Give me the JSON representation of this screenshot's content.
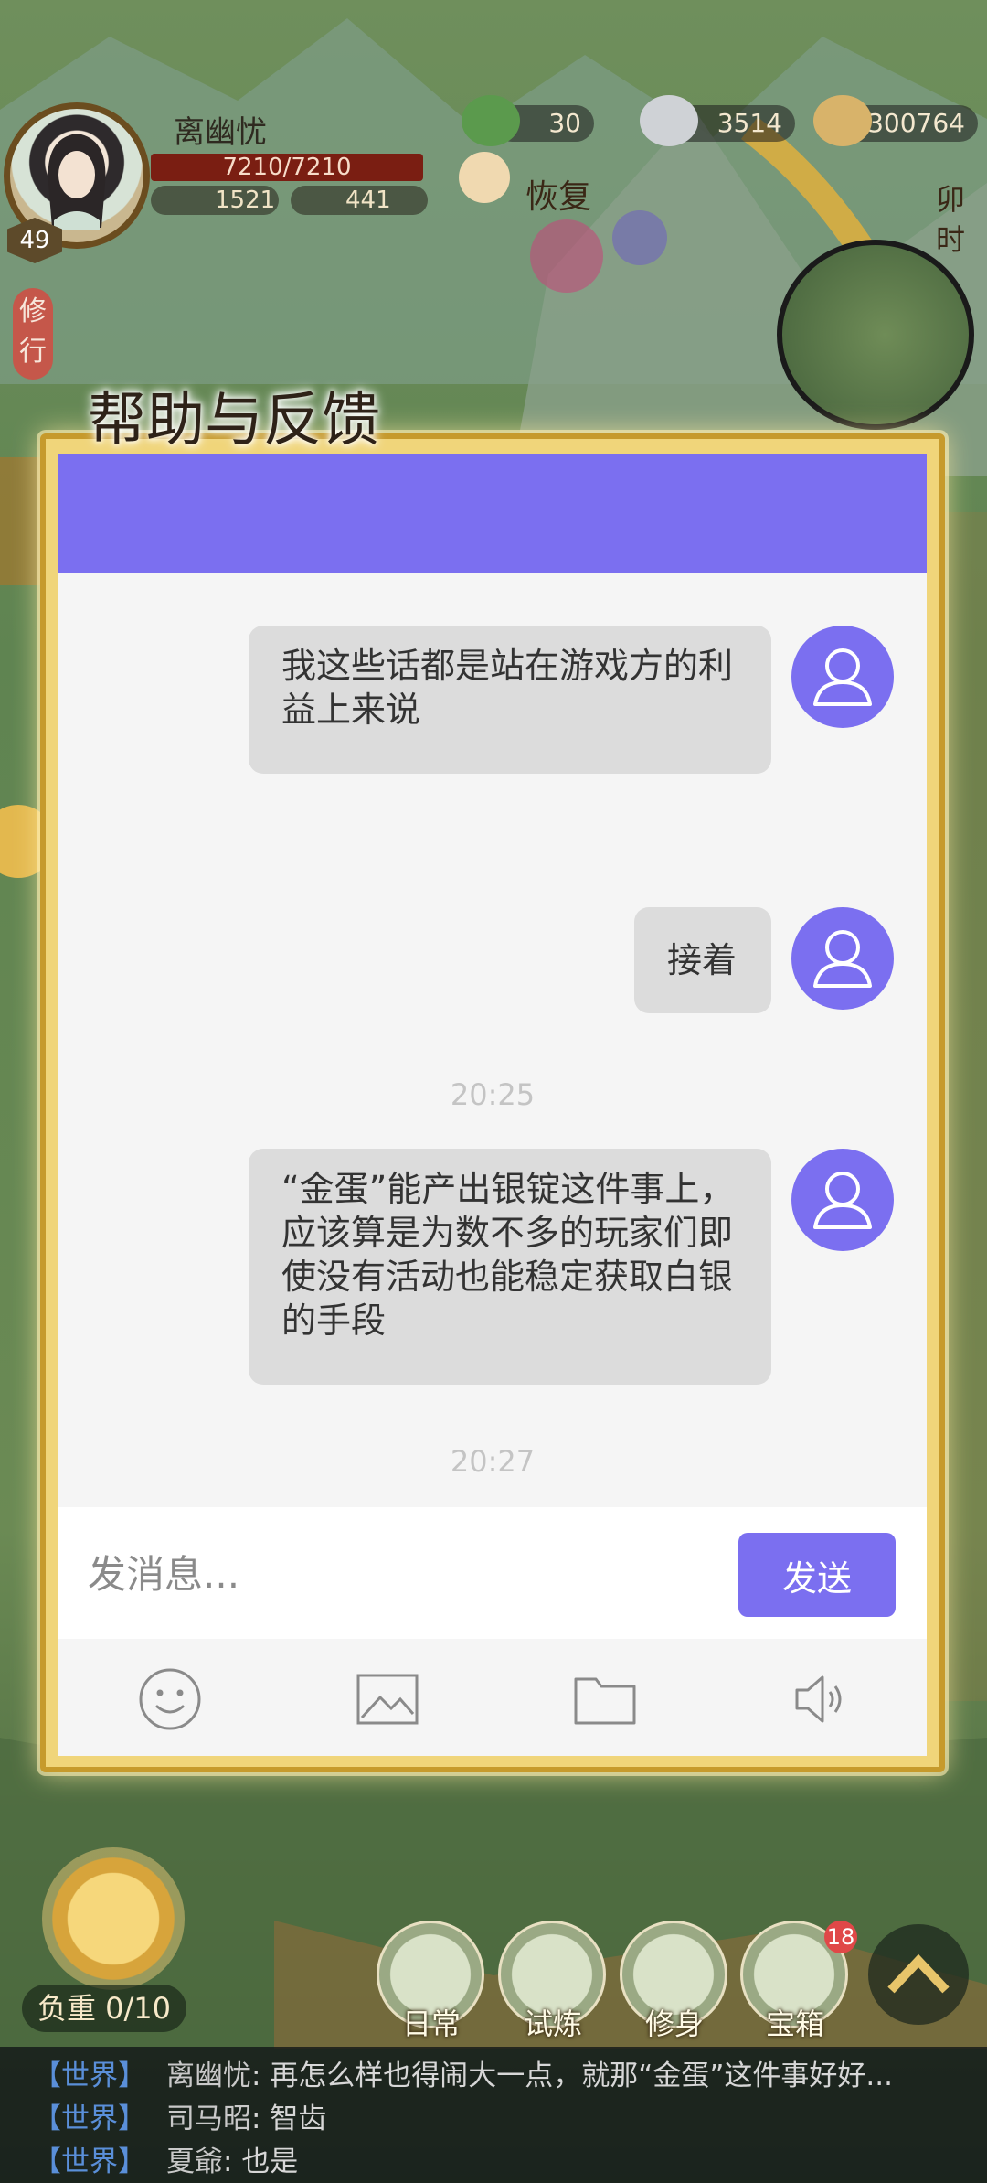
{
  "player": {
    "name": "离幽忧",
    "hp": "7210/7210",
    "stat_a": "1521",
    "stat_b": "441",
    "level": "49"
  },
  "resources": [
    "30",
    "3514",
    "300764"
  ],
  "recover_label": "恢复",
  "time_of_day": "卯时",
  "cultivate_label": "修行",
  "dialog": {
    "title": "帮助与反馈",
    "messages": [
      {
        "text": "我这些话都是站在游戏方的利益上来说"
      },
      {
        "text": "接着"
      },
      {
        "timestamp": "20:25"
      },
      {
        "text": "“金蛋”能产出银锭这件事上，应该算是为数不多的玩家们即使没有活动也能稳定获取白银的手段"
      },
      {
        "timestamp": "20:27"
      }
    ],
    "input_placeholder": "发消息...",
    "send_label": "发送"
  },
  "bottom": {
    "weight_label": "负重 0/10",
    "menu": [
      {
        "label": "日常"
      },
      {
        "label": "试炼"
      },
      {
        "label": "修身"
      },
      {
        "label": "宝箱",
        "badge": "18"
      }
    ]
  },
  "chat": [
    {
      "channel": "【世界】",
      "speaker": "离幽忧",
      "text": "再怎么样也得闹大一点，就那“金蛋”这件事好好..."
    },
    {
      "channel": "【世界】",
      "speaker": "司马昭",
      "text": "智齿"
    },
    {
      "channel": "【世界】",
      "speaker": "夏爺",
      "text": "也是"
    }
  ],
  "colors": {
    "accent": "#7b6ff0",
    "bubble": "#dcdcdc",
    "frame_gold": "#c69a2c"
  }
}
